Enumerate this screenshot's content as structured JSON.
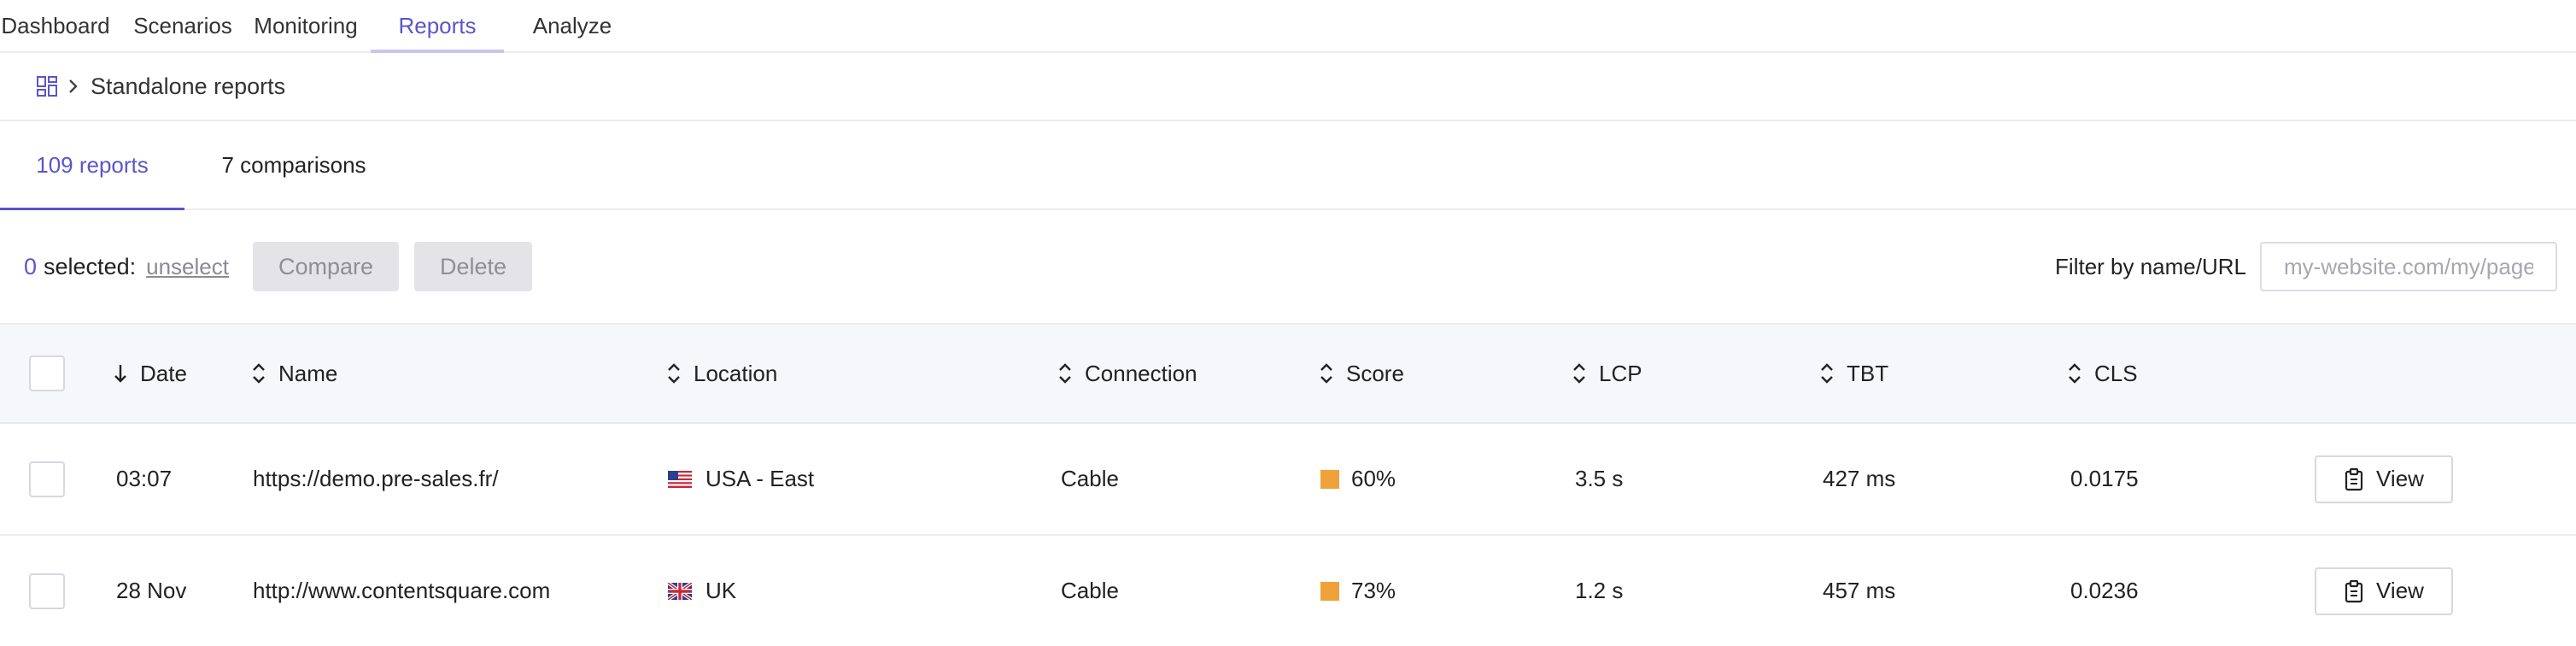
{
  "nav": {
    "items": [
      {
        "label": "Dashboard"
      },
      {
        "label": "Scenarios"
      },
      {
        "label": "Monitoring"
      },
      {
        "label": "Reports"
      },
      {
        "label": "Analyze"
      }
    ],
    "active": "Reports"
  },
  "breadcrumb": {
    "icon": "grid-icon",
    "label": "Standalone reports"
  },
  "tabs": [
    {
      "label": "109 reports",
      "active": true
    },
    {
      "label": "7 comparisons",
      "active": false
    }
  ],
  "toolbar": {
    "selected_count": "0",
    "selected_label": "selected:",
    "unselect_label": "unselect",
    "compare_label": "Compare",
    "delete_label": "Delete",
    "filter_label": "Filter by name/URL",
    "filter_placeholder": "my-website.com/my/page",
    "filter_value": ""
  },
  "table": {
    "columns": [
      {
        "label": "Date",
        "sort": "desc"
      },
      {
        "label": "Name",
        "sort": "none"
      },
      {
        "label": "Location",
        "sort": "none"
      },
      {
        "label": "Connection",
        "sort": "none"
      },
      {
        "label": "Score",
        "sort": "none"
      },
      {
        "label": "LCP",
        "sort": "none"
      },
      {
        "label": "TBT",
        "sort": "none"
      },
      {
        "label": "CLS",
        "sort": "none"
      }
    ],
    "rows": [
      {
        "date": "03:07",
        "name": "https://demo.pre-sales.fr/",
        "flag": "us-flag-icon",
        "location": "USA - East",
        "connection": "Cable",
        "score": "60%",
        "score_color": "#f0a23a",
        "lcp": "3.5 s",
        "tbt": "427 ms",
        "cls": "0.0175",
        "action_label": "View"
      },
      {
        "date": "28 Nov",
        "name": "http://www.contentsquare.com",
        "flag": "uk-flag-icon",
        "location": "UK",
        "connection": "Cable",
        "score": "73%",
        "score_color": "#f0a23a",
        "lcp": "1.2 s",
        "tbt": "457 ms",
        "cls": "0.0236",
        "action_label": "View"
      }
    ]
  },
  "colors": {
    "accent": "#5a55cc",
    "score_orange": "#f0a23a",
    "header_bg": "#f6f7fb"
  }
}
